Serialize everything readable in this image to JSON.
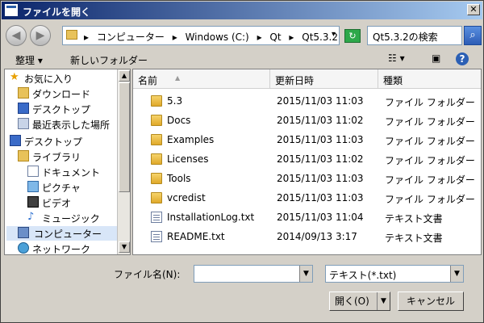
{
  "window": {
    "title": "ファイルを開く",
    "close": "✕"
  },
  "nav": {
    "back": "◀",
    "forward": "▶",
    "crumbs": [
      "▸",
      "コンピューター",
      "▸",
      "Windows (C:)",
      "▸",
      "Qt",
      "▸",
      "Qt5.3.2",
      "▸"
    ],
    "address_dropdown": "▾",
    "search_placeholder": "Qt5.3.2の検索"
  },
  "toolbar": {
    "organize": "整理 ▾",
    "new_folder": "新しいフォルダー",
    "views": "☷ ▾",
    "preview": "▣",
    "help": "?"
  },
  "sidebar": {
    "items": [
      {
        "label": "お気に入り",
        "icon": "star-icon"
      },
      {
        "label": "ダウンロード",
        "icon": "download-folder-icon"
      },
      {
        "label": "デスクトップ",
        "icon": "desktop-icon"
      },
      {
        "label": "最近表示した場所",
        "icon": "recent-places-icon"
      },
      {
        "label": "デスクトップ",
        "icon": "desktop-icon"
      },
      {
        "label": "ライブラリ",
        "icon": "library-icon"
      },
      {
        "label": "ドキュメント",
        "icon": "documents-icon"
      },
      {
        "label": "ピクチャ",
        "icon": "pictures-icon"
      },
      {
        "label": "ビデオ",
        "icon": "videos-icon"
      },
      {
        "label": "ミュージック",
        "icon": "music-icon"
      },
      {
        "label": "コンピューター",
        "icon": "computer-icon"
      },
      {
        "label": "ネットワーク",
        "icon": "network-icon"
      }
    ]
  },
  "list": {
    "columns": [
      "名前",
      "更新日時",
      "種類"
    ],
    "sort_indicator": "▲",
    "rows": [
      {
        "name": "5.3",
        "date": "2015/11/03 11:03",
        "type": "ファイル フォルダー",
        "kind": "folder"
      },
      {
        "name": "Docs",
        "date": "2015/11/03 11:02",
        "type": "ファイル フォルダー",
        "kind": "folder"
      },
      {
        "name": "Examples",
        "date": "2015/11/03 11:03",
        "type": "ファイル フォルダー",
        "kind": "folder"
      },
      {
        "name": "Licenses",
        "date": "2015/11/03 11:02",
        "type": "ファイル フォルダー",
        "kind": "folder"
      },
      {
        "name": "Tools",
        "date": "2015/11/03 11:03",
        "type": "ファイル フォルダー",
        "kind": "folder"
      },
      {
        "name": "vcredist",
        "date": "2015/11/03 11:03",
        "type": "ファイル フォルダー",
        "kind": "folder"
      },
      {
        "name": "InstallationLog.txt",
        "date": "2015/11/03 11:04",
        "type": "テキスト文書",
        "kind": "text"
      },
      {
        "name": "README.txt",
        "date": "2014/09/13 3:17",
        "type": "テキスト文書",
        "kind": "text"
      }
    ]
  },
  "footer": {
    "filename_label": "ファイル名(N):",
    "filename_value": "",
    "filetype": "テキスト(*.txt)",
    "open_label": "開く(O)",
    "cancel_label": "キャンセル"
  }
}
